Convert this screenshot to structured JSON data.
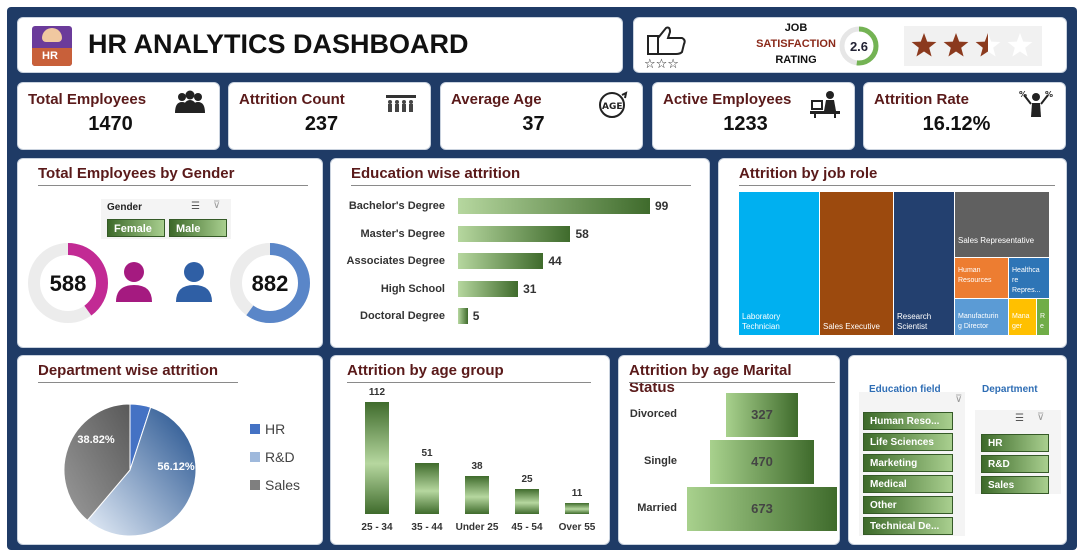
{
  "header": {
    "title": "HR ANALYTICS DASHBOARD",
    "logo_text": "HR"
  },
  "satisfaction": {
    "label_line1": "JOB",
    "label_line2": "SATISFACTION",
    "label_line3": "RATING",
    "rating": "2.6",
    "rating_value": 2.6,
    "star_rating_value": 2.5,
    "star_max": 4
  },
  "kpis": [
    {
      "label": "Total Employees",
      "value": "1470",
      "icon": "group-icon"
    },
    {
      "label": "Attrition Count",
      "value": "237",
      "icon": "people-leaving-icon"
    },
    {
      "label": "Average Age",
      "value": "37",
      "icon": "age-icon"
    },
    {
      "label": "Active Employees",
      "value": "1233",
      "icon": "desk-worker-icon"
    },
    {
      "label": "Attrition Rate",
      "value": "16.12%",
      "icon": "person-percent-icon"
    }
  ],
  "gender": {
    "title": "Total Employees by Gender",
    "slicer_title": "Gender",
    "buttons": [
      "Female",
      "Male"
    ],
    "female_value": "588",
    "male_value": "882",
    "female_fraction": 0.4,
    "male_fraction": 0.6,
    "female_color": "#b0177e",
    "male_color": "#2f5fa5"
  },
  "education_attrition": {
    "title": "Education wise attrition",
    "chart_data": {
      "type": "bar",
      "orientation": "horizontal",
      "categories": [
        "Bachelor's Degree",
        "Master's Degree",
        "Associates Degree",
        "High School",
        "Doctoral Degree"
      ],
      "values": [
        99,
        58,
        44,
        31,
        5
      ],
      "labels": [
        "99",
        "58",
        "44",
        "31",
        "5"
      ]
    }
  },
  "job_role": {
    "title": "Attrition by job role",
    "chart_data": {
      "type": "treemap",
      "items": [
        {
          "name": "Laboratory Technician",
          "line1": "Laboratory",
          "line2": "Technician",
          "color": "#00b0f0"
        },
        {
          "name": "Sales Executive",
          "line1": "Sales Executive",
          "line2": "",
          "color": "#9c4a0e"
        },
        {
          "name": "Research Scientist",
          "line1": "Research",
          "line2": "Scientist",
          "color": "#23406f"
        },
        {
          "name": "Sales Representative",
          "line1": "Sales Representative",
          "line2": "",
          "color": "#606060"
        },
        {
          "name": "Human Resources",
          "line1": "Human",
          "line2": "Resources",
          "color": "#ed7d31"
        },
        {
          "name": "Healthcare Representative",
          "line1": "Healthca",
          "line2": "re",
          "line3": "Repres...",
          "color": "#2e75b6"
        },
        {
          "name": "Manufacturing Director",
          "line1": "Manufacturin",
          "line2": "g Director",
          "color": "#5b9bd5"
        },
        {
          "name": "Manager",
          "line1": "Mana",
          "line2": "ger",
          "color": "#ffc000"
        },
        {
          "name": "Research Director",
          "line1": "R",
          "line2": "e",
          "color": "#70ad47"
        }
      ]
    }
  },
  "department": {
    "title": "Department wise attrition",
    "chart_data": {
      "type": "pie",
      "categories": [
        "HR",
        "R&D",
        "Sales"
      ],
      "values": [
        5.06,
        56.12,
        38.82
      ],
      "labels": [
        "5.06%",
        "56.12%",
        "38.82%"
      ],
      "colors": [
        "#4472c4",
        "#9fb9dc",
        "#7f7f7f"
      ]
    }
  },
  "age_group": {
    "title": "Attrition by age group",
    "chart_data": {
      "type": "bar",
      "categories": [
        "25 - 34",
        "35 - 44",
        "Under 25",
        "45 - 54",
        "Over 55"
      ],
      "values": [
        112,
        51,
        38,
        25,
        11
      ],
      "labels": [
        "112",
        "51",
        "38",
        "25",
        "11"
      ]
    }
  },
  "marital": {
    "title": "Attrition by age Marital Status",
    "chart_data": {
      "type": "funnel",
      "categories": [
        "Divorced",
        "Single",
        "Married"
      ],
      "values": [
        327,
        470,
        673
      ],
      "labels": [
        "327",
        "470",
        "673"
      ]
    }
  },
  "slicers": {
    "education_title": "Education field",
    "education_items": [
      "Human Reso...",
      "Life Sciences",
      "Marketing",
      "Medical",
      "Other",
      "Technical De..."
    ],
    "department_title": "Department",
    "department_items": [
      "HR",
      "R&D",
      "Sales"
    ]
  },
  "colors": {
    "frame": "#1f3b66",
    "title_text": "#5a1a1a",
    "bar_dark": "#3f6b2c",
    "bar_light": "#b6d79f",
    "star": "#8b3a1e"
  }
}
